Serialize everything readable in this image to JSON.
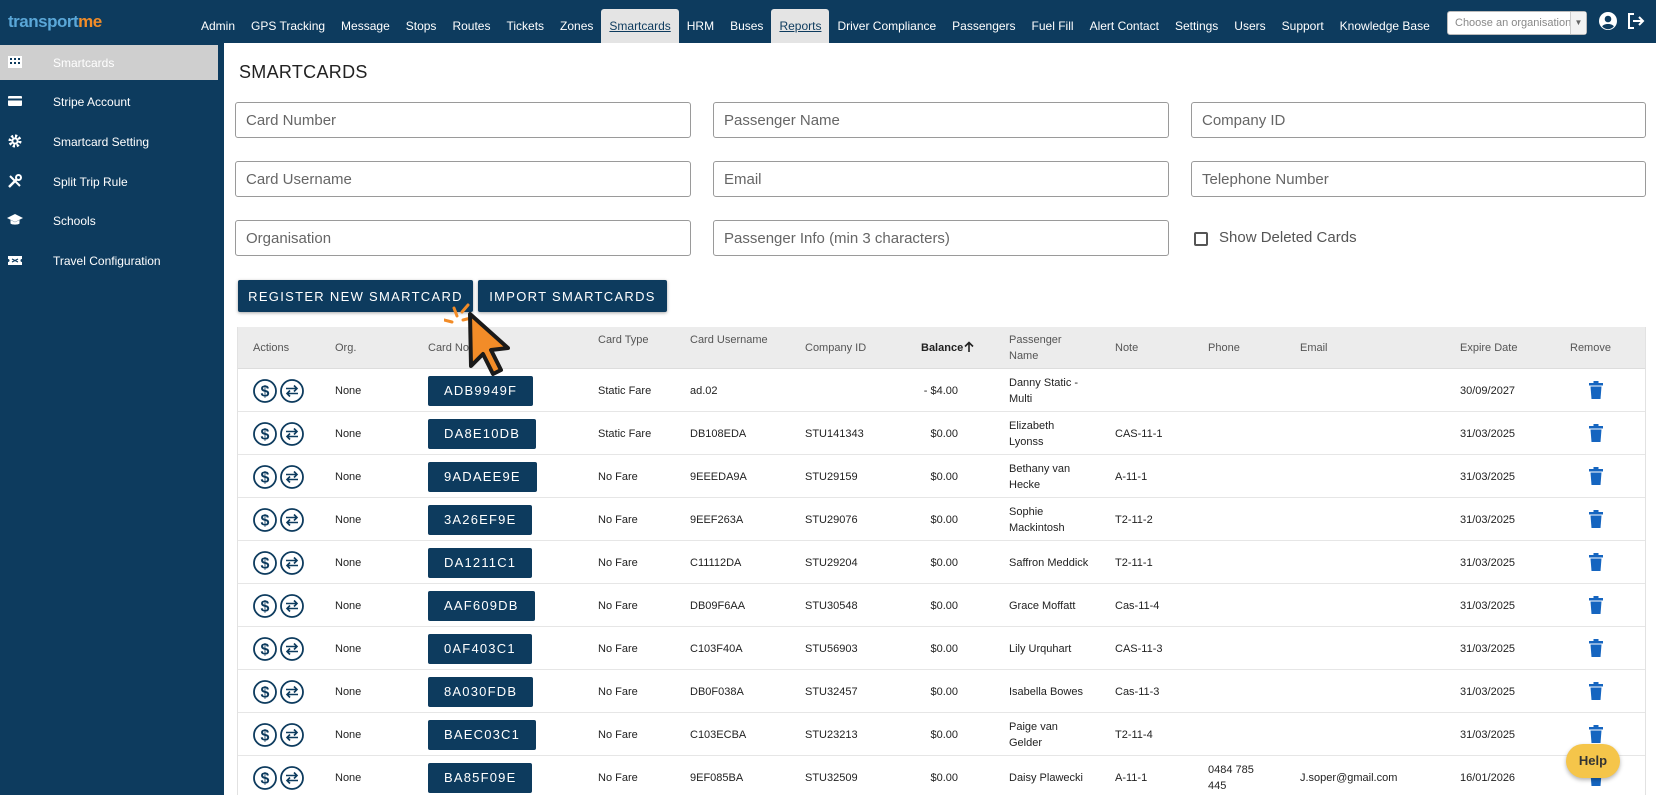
{
  "brand": {
    "logo_part1": "transport",
    "logo_part2": "me"
  },
  "nav": {
    "items": [
      {
        "label": "Admin"
      },
      {
        "label": "GPS Tracking"
      },
      {
        "label": "Message"
      },
      {
        "label": "Stops"
      },
      {
        "label": "Routes"
      },
      {
        "label": "Tickets"
      },
      {
        "label": "Zones"
      },
      {
        "label": "Smartcards",
        "active": true
      },
      {
        "label": "HRM"
      },
      {
        "label": "Buses"
      },
      {
        "label": "Reports",
        "active": true
      },
      {
        "label": "Driver Compliance"
      },
      {
        "label": "Passengers"
      },
      {
        "label": "Fuel Fill"
      },
      {
        "label": "Alert Contact"
      },
      {
        "label": "Settings"
      },
      {
        "label": "Users"
      },
      {
        "label": "Support"
      },
      {
        "label": "Knowledge Base"
      }
    ],
    "org_placeholder": "Choose an organisation"
  },
  "sidebar": {
    "items": [
      {
        "label": "Smartcards",
        "icon": "building-icon",
        "active": true
      },
      {
        "label": "Stripe Account",
        "icon": "credit-card-icon"
      },
      {
        "label": "Smartcard Setting",
        "icon": "gear-icon"
      },
      {
        "label": "Split Trip Rule",
        "icon": "tools-icon"
      },
      {
        "label": "Schools",
        "icon": "graduation-cap-icon"
      },
      {
        "label": "Travel Configuration",
        "icon": "ticket-icon"
      }
    ]
  },
  "page": {
    "title": "SMARTCARDS"
  },
  "filters": {
    "card_number": "Card Number",
    "passenger_name": "Passenger Name",
    "company_id": "Company ID",
    "card_username": "Card Username",
    "email": "Email",
    "telephone": "Telephone Number",
    "organisation": "Organisation",
    "passenger_info": "Passenger Info (min 3 characters)",
    "show_deleted": "Show Deleted Cards"
  },
  "buttons": {
    "register": "REGISTER NEW SMARTCARD",
    "import": "IMPORT SMARTCARDS"
  },
  "table": {
    "headers": {
      "actions": "Actions",
      "org": "Org.",
      "card_no": "Card No.",
      "card_type": "Card Type",
      "card_username": "Card Username",
      "company_id": "Company ID",
      "balance": "Balance",
      "passenger_name": "Passenger Name",
      "note": "Note",
      "phone": "Phone",
      "email": "Email",
      "expire_date": "Expire Date",
      "remove": "Remove"
    },
    "rows": [
      {
        "org": "None",
        "card_no": "ADB9949F",
        "card_type": "Static Fare",
        "username": "ad.02",
        "company_id": "",
        "balance": "- $4.00",
        "passenger": "Danny Static - Multi",
        "note": "",
        "phone": "",
        "email": "",
        "expire": "30/09/2027"
      },
      {
        "org": "None",
        "card_no": "DA8E10DB",
        "card_type": "Static Fare",
        "username": "DB108EDA",
        "company_id": "STU141343",
        "balance": "$0.00",
        "passenger": "Elizabeth Lyonss",
        "note": "CAS-11-1",
        "phone": "",
        "email": "",
        "expire": "31/03/2025"
      },
      {
        "org": "None",
        "card_no": "9ADAEE9E",
        "card_type": "No Fare",
        "username": "9EEEDA9A",
        "company_id": "STU29159",
        "balance": "$0.00",
        "passenger": "Bethany van Hecke",
        "note": "A-11-1",
        "phone": "",
        "email": "",
        "expire": "31/03/2025"
      },
      {
        "org": "None",
        "card_no": "3A26EF9E",
        "card_type": "No Fare",
        "username": "9EEF263A",
        "company_id": "STU29076",
        "balance": "$0.00",
        "passenger": "Sophie Mackintosh",
        "note": "T2-11-2",
        "phone": "",
        "email": "",
        "expire": "31/03/2025"
      },
      {
        "org": "None",
        "card_no": "DA1211C1",
        "card_type": "No Fare",
        "username": "C11112DA",
        "company_id": "STU29204",
        "balance": "$0.00",
        "passenger": "Saffron Meddick",
        "note": "T2-11-1",
        "phone": "",
        "email": "",
        "expire": "31/03/2025"
      },
      {
        "org": "None",
        "card_no": "AAF609DB",
        "card_type": "No Fare",
        "username": "DB09F6AA",
        "company_id": "STU30548",
        "balance": "$0.00",
        "passenger": "Grace Moffatt",
        "note": "Cas-11-4",
        "phone": "",
        "email": "",
        "expire": "31/03/2025"
      },
      {
        "org": "None",
        "card_no": "0AF403C1",
        "card_type": "No Fare",
        "username": "C103F40A",
        "company_id": "STU56903",
        "balance": "$0.00",
        "passenger": "Lily Urquhart",
        "note": "CAS-11-3",
        "phone": "",
        "email": "",
        "expire": "31/03/2025"
      },
      {
        "org": "None",
        "card_no": "8A030FDB",
        "card_type": "No Fare",
        "username": "DB0F038A",
        "company_id": "STU32457",
        "balance": "$0.00",
        "passenger": "Isabella Bowes",
        "note": "Cas-11-3",
        "phone": "",
        "email": "",
        "expire": "31/03/2025"
      },
      {
        "org": "None",
        "card_no": "BAEC03C1",
        "card_type": "No Fare",
        "username": "C103ECBA",
        "company_id": "STU23213",
        "balance": "$0.00",
        "passenger": "Paige van Gelder",
        "note": "T2-11-4",
        "phone": "",
        "email": "",
        "expire": "31/03/2025"
      },
      {
        "org": "None",
        "card_no": "BA85F09E",
        "card_type": "No Fare",
        "username": "9EF085BA",
        "company_id": "STU32509",
        "balance": "$0.00",
        "passenger": "Daisy Plawecki",
        "note": "A-11-1",
        "phone": "0484 785 445",
        "email": "J.soper@gmail.com",
        "expire": "16/01/2026"
      }
    ]
  },
  "help": {
    "label": "Help"
  },
  "colors": {
    "navy": "#0d3b5e",
    "accent_orange": "#f28c28",
    "trash_blue": "#1565c0",
    "help_yellow": "#f5c54a"
  }
}
